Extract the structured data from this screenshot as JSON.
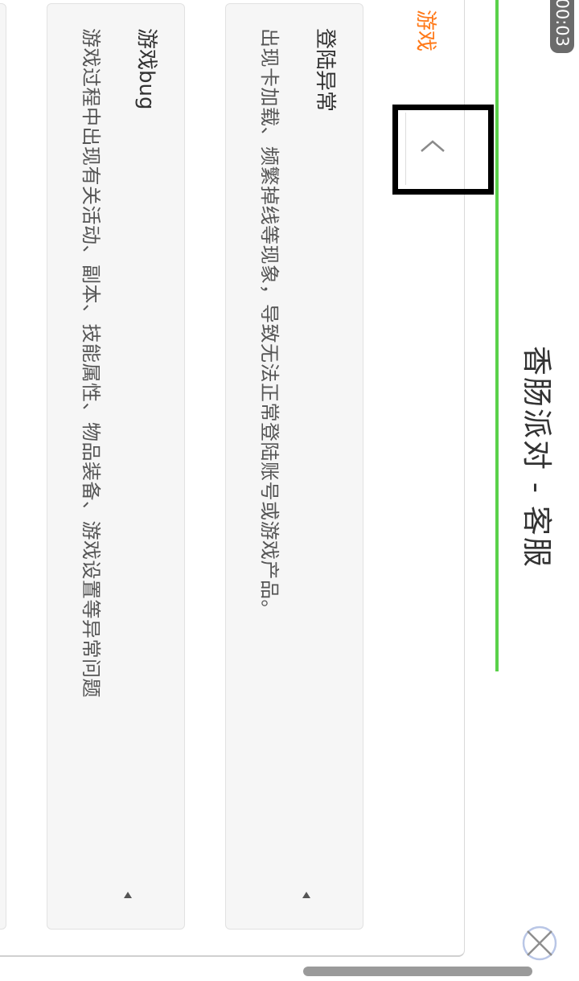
{
  "status": {
    "time": "00:03"
  },
  "header": {
    "title": "香肠派对 - 客服",
    "accent_color": "#5ad14a"
  },
  "sidebar": {
    "tab_label": "游戏",
    "tab_color": "#ff7a1a"
  },
  "cards": [
    {
      "title": "登陆异常",
      "description": "出现卡加载、频繁掉线等现象，导致无法正常登陆账号或游戏产品。"
    },
    {
      "title": "游戏bug",
      "description": "游戏过程中出现有关活动、副本、技能属性、物品装备、游戏设置等异常问题"
    }
  ],
  "icons": {
    "close": "close-icon",
    "back": "chevron-left-icon",
    "card_arrow": "triangle-left-icon"
  }
}
